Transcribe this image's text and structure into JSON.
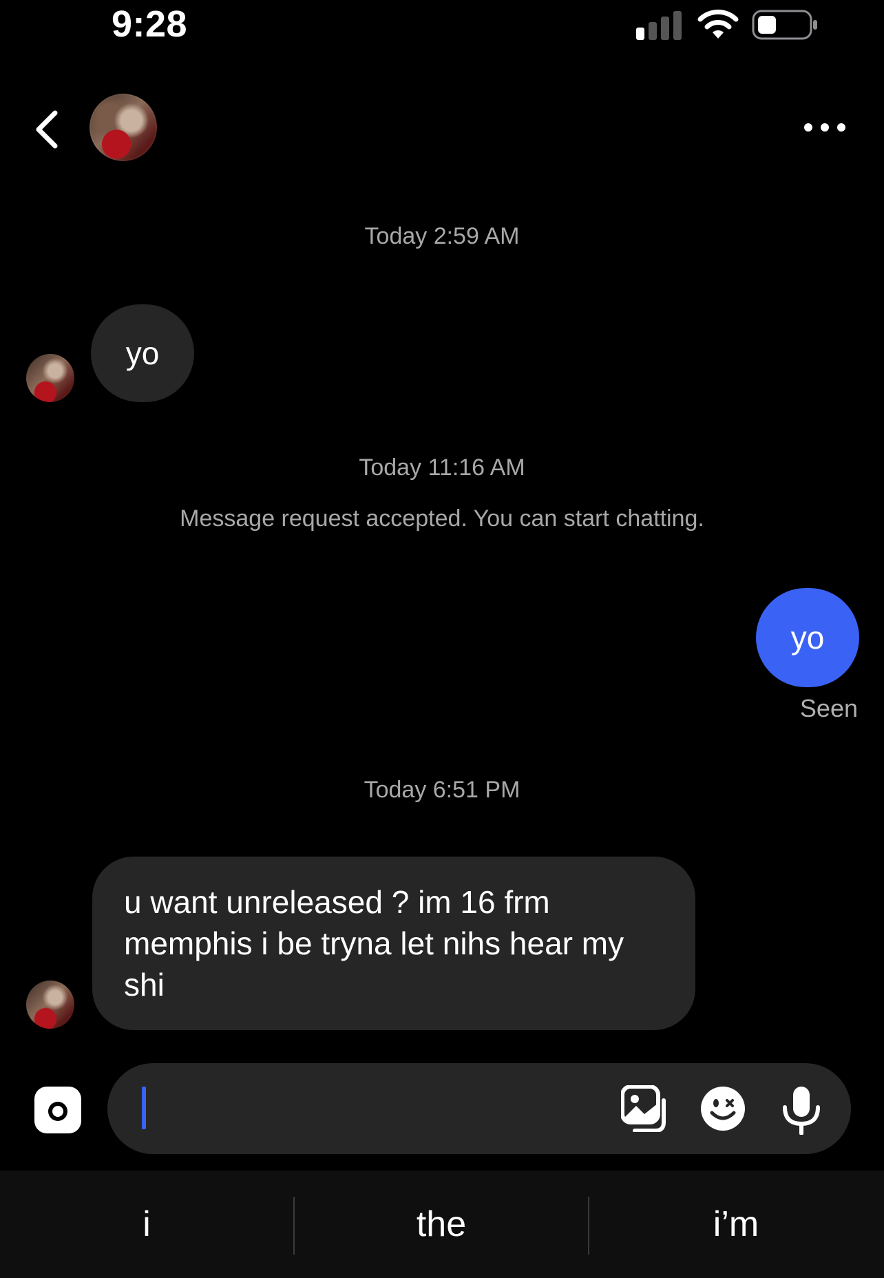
{
  "status_bar": {
    "time": "9:28",
    "icons": [
      "cellular-signal-icon",
      "wifi-icon",
      "battery-icon"
    ]
  },
  "header": {
    "back_icon": "chevron-left-icon",
    "more_icon": "more-horizontal-icon"
  },
  "messages": {
    "timestamp_1": "Today 2:59 AM",
    "incoming_1": "yo",
    "timestamp_2": "Today 11:16 AM",
    "system_note": "Message request accepted. You can start chatting.",
    "outgoing_1": "yo",
    "seen": "Seen",
    "timestamp_3": "Today 6:51 PM",
    "incoming_2_line_1": "u want unreleased ? im 16 frm",
    "incoming_2_line_2": "memphis i be tryna let nihs hear my",
    "incoming_2_line_3": "shi"
  },
  "composer": {
    "icons": [
      "camera-icon",
      "gallery-icon",
      "sticker-icon",
      "microphone-icon"
    ],
    "value": ""
  },
  "keyboard_suggestions": [
    "i",
    "the",
    "i’m"
  ],
  "colors": {
    "background": "#000000",
    "incoming_bubble": "#262626",
    "outgoing_bubble": "#3a63f5",
    "secondary_text": "#a8a8a8"
  }
}
